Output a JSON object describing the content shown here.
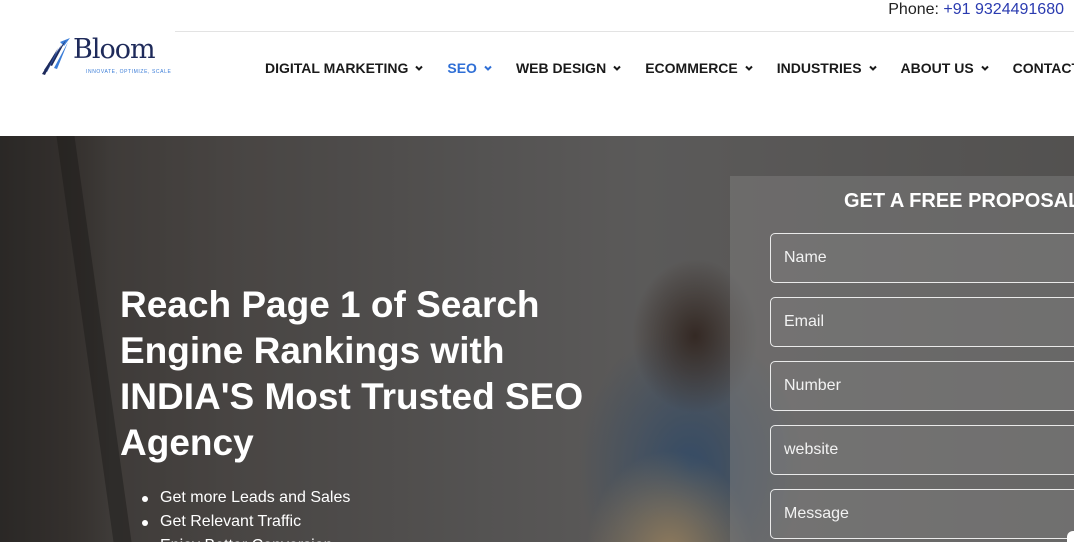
{
  "topbar": {
    "phone_label": "Phone:",
    "phone_number": "+91 9324491680"
  },
  "logo": {
    "name": "Bloom",
    "tagline": "INNOVATE, OPTIMIZE, SCALE"
  },
  "nav": {
    "items": [
      {
        "label": "DIGITAL MARKETING",
        "has_dropdown": true
      },
      {
        "label": "SEO",
        "has_dropdown": true,
        "active": true
      },
      {
        "label": "WEB DESIGN",
        "has_dropdown": true
      },
      {
        "label": "ECOMMERCE",
        "has_dropdown": true
      },
      {
        "label": "INDUSTRIES",
        "has_dropdown": true
      },
      {
        "label": "ABOUT US",
        "has_dropdown": true
      },
      {
        "label": "CONTACT US",
        "has_dropdown": false
      }
    ]
  },
  "hero": {
    "headline": "Reach Page 1 of Search Engine Rankings with INDIA'S Most Trusted SEO Agency",
    "bullets": [
      "Get more Leads and Sales",
      "Get Relevant Traffic",
      "Enjoy Better Conversion"
    ]
  },
  "form": {
    "title": "GET A FREE PROPOSAL",
    "name_placeholder": "Name",
    "email_placeholder": "Email",
    "number_placeholder": "Number",
    "website_placeholder": "website",
    "message_placeholder": "Message"
  },
  "colors": {
    "accent": "#2f6fd6",
    "phone_link": "#2a3bb0",
    "logo_navy": "#1e2a5a"
  }
}
